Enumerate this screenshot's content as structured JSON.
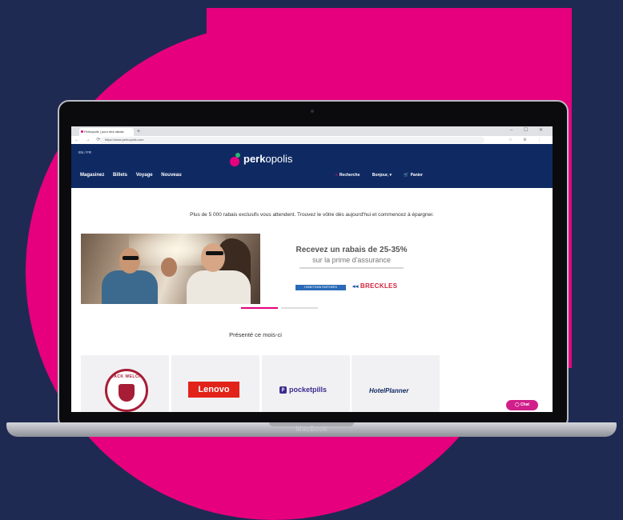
{
  "browser": {
    "tab_title": "Perkopolis | pour des rabais",
    "new_tab": "+",
    "window_controls": "– ☐ ✕",
    "nav_icons": "← → ⟳ ⌂",
    "url": "https://www.perkopolis.com",
    "extension_icons": "☆ ⚙ ⋮"
  },
  "site": {
    "language": "EN / FR",
    "logo_bold": "perk",
    "logo_regular": "opolis",
    "nav": [
      "Magasinez",
      "Billets",
      "Voyage",
      "Nouveau"
    ],
    "search_label": "Recherche",
    "greeting": "Bonjour,",
    "user_chevron": "▾",
    "cart_label": "Panier",
    "search_icon": "search-icon",
    "cart_icon": "cart-icon"
  },
  "main": {
    "intro": "Plus de 5 000 rabais exclusifs vous attendent. Trouvez le vôtre dès aujourd'hui et commencez à épargner.",
    "promo": {
      "title": "Recevez un rabais de 25-35%",
      "subtitle": "sur la prime d'assurance",
      "partner1": "HOMETOWN PARTNERS",
      "partner2": "BRECKLES"
    },
    "carousel": {
      "slides": 2,
      "active": 1
    },
    "section_title": "Présenté ce mois-ci",
    "brands": [
      "JACK WELCH",
      "Lenovo",
      "pocketpills",
      "HotelPlanner"
    ]
  },
  "chat": {
    "label": "Chat",
    "icon": "chat-icon"
  },
  "device_label": "MacBook",
  "colors": {
    "background": "#1f2a52",
    "accent": "#e6007e",
    "header": "#0f2a63",
    "lenovo": "#e2231a"
  }
}
